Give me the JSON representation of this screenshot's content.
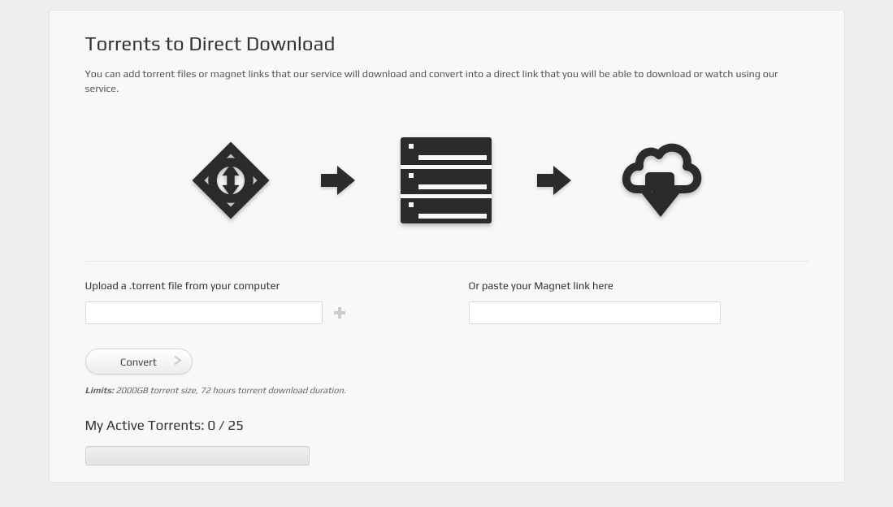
{
  "header": {
    "title": "Torrents to Direct Download",
    "intro": "You can add torrent files or magnet links that our service will download and convert into a direct link that you will be able to download or watch using our service."
  },
  "upload": {
    "torrent_label": "Upload a .torrent file from your computer",
    "magnet_label": "Or paste your Magnet link here",
    "torrent_value": "",
    "magnet_value": ""
  },
  "convert": {
    "button_label": "Convert"
  },
  "limits": {
    "label": "Limits:",
    "text": "2000GB torrent size, 72 hours torrent download duration."
  },
  "active": {
    "label": "My Active Torrents:",
    "current": 0,
    "max": 25
  }
}
